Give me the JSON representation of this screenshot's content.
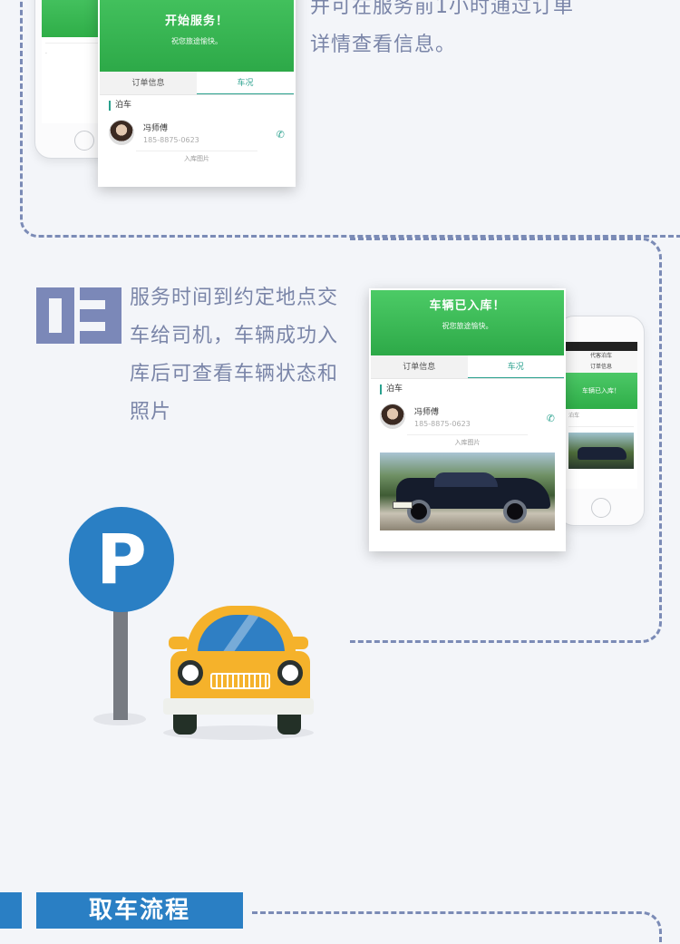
{
  "step2": {
    "description": "并可在服务前1小时通过订单详情查看信息。"
  },
  "step3": {
    "number": "03",
    "description": "服务时间到约定地点交车给司机，车辆成功入库后可查看车辆状态和照片"
  },
  "card_start": {
    "title": "开始服务！",
    "subtitle": "祝您旅途愉快。",
    "tabs": [
      "订单信息",
      "车况"
    ],
    "section": "泊车",
    "driver_name": "冯师傅",
    "driver_phone": "185-8875-0623",
    "photo_label": "入库图片"
  },
  "card_parked": {
    "title": "车辆已入库！",
    "subtitle": "祝您旅途愉快。",
    "tabs": [
      "订单信息",
      "车况"
    ],
    "section": "泊车",
    "driver_name": "冯师傅",
    "driver_phone": "185-8875-0623",
    "photo_label": "入库图片"
  },
  "phone_back_right": {
    "nav_title": "代客泊车",
    "tab": "订单信息",
    "banner": "车辆已入库！",
    "section": "泊车"
  },
  "parking_sign": {
    "letter": "P"
  },
  "section_header": {
    "label": "取车流程"
  },
  "colors": {
    "accent_blue": "#2a7fc4",
    "dash_line": "#7b8bb6",
    "app_green": "#35b24f",
    "taxi_yellow": "#f5b22b",
    "text_muted": "#7a85a8"
  },
  "icons": [
    "phone-icon",
    "parking-sign-icon",
    "taxi-icon",
    "avatar"
  ]
}
